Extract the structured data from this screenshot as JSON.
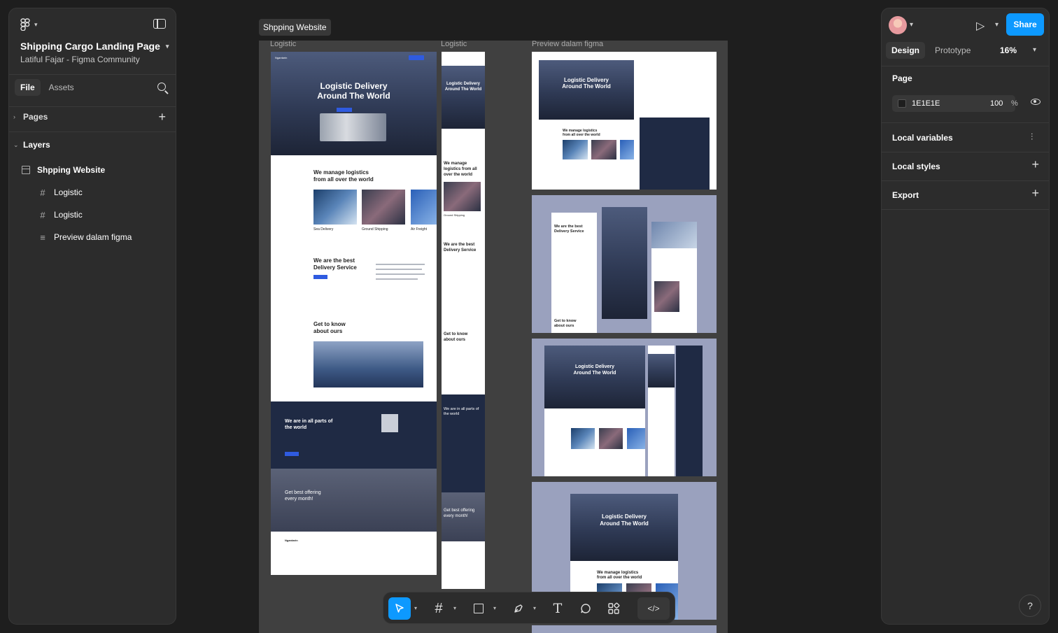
{
  "left_panel": {
    "file_title": "Shipping Cargo Landing Page",
    "file_subtitle": "Latiful Fajar - Figma Community",
    "tabs": [
      "File",
      "Assets"
    ],
    "pages_label": "Pages",
    "layers_label": "Layers",
    "layers": [
      {
        "label": "Shpping Website",
        "icon": "section-icon"
      },
      {
        "label": "Logistic",
        "icon": "frame-icon"
      },
      {
        "label": "Logistic",
        "icon": "frame-icon"
      },
      {
        "label": "Preview dalam figma",
        "icon": "text-lines-icon"
      }
    ]
  },
  "right_panel": {
    "share_label": "Share",
    "tabs": [
      "Design",
      "Prototype"
    ],
    "zoom": "16%",
    "page_label": "Page",
    "page_fill_hex": "1E1E1E",
    "page_fill_opacity": "100",
    "page_fill_pct": "%",
    "local_variables": "Local variables",
    "local_styles": "Local styles",
    "export": "Export",
    "help": "?"
  },
  "canvas": {
    "section_tag": "Shpping Website",
    "frame_labels": [
      "Logistic",
      "Logistic",
      "Preview dalam figma"
    ],
    "hero_title_1": "Logistic Delivery",
    "hero_title_2": "Around The World",
    "manage_1": "We manage logistics",
    "manage_2": "from all over the world",
    "service_labels": [
      "Sea Delivery",
      "Ground Shipping",
      "Air Freight"
    ],
    "best_1": "We are the best",
    "best_2": "Delivery Service",
    "know_1": "Get to know",
    "know_2": "about ours",
    "parts_1": "We are in all parts of",
    "parts_2": "the world",
    "offer_1": "Get best offering",
    "offer_2": "every month!",
    "brand": "Ngantarin",
    "mobile_hero_1": "Logistic Delivery",
    "mobile_hero_2": "Around The World",
    "mobile_manage": "We manage logistics from all over the world",
    "mobile_services": [
      "Ground Shipping"
    ]
  },
  "toolbar": {
    "tools": [
      "move-tool",
      "frame-tool",
      "shape-tool",
      "pen-tool",
      "text-tool",
      "comment-tool",
      "components-tool",
      "dev-mode"
    ],
    "code_label": "</>"
  },
  "colors": {
    "accent": "#0d99ff",
    "panel": "#2c2c2c",
    "canvas": "#1e1e1e",
    "navy": "#1f2a44",
    "brand_blue": "#2f5be0"
  }
}
